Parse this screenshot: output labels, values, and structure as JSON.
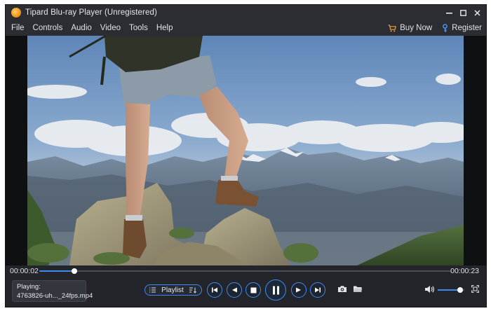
{
  "window": {
    "title": "Tipard Blu-ray Player (Unregistered)"
  },
  "menu": {
    "items": [
      "File",
      "Controls",
      "Audio",
      "Video",
      "Tools",
      "Help"
    ],
    "buy_now": "Buy Now",
    "register": "Register"
  },
  "player": {
    "time_elapsed": "00:00:02",
    "time_total": "00:00:23",
    "progress": 0.086,
    "volume": 0.85
  },
  "now_playing": {
    "label": "Playing:",
    "file": "4763826-uh..._24fps.mp4"
  },
  "playlist": {
    "label": "Playlist"
  },
  "colors": {
    "accent": "#3c8cf0",
    "background": "#23252a",
    "titlebar": "#2b2d33"
  },
  "icons": [
    "app-logo-icon",
    "minimize-icon",
    "maximize-icon",
    "close-icon",
    "cart-icon",
    "key-icon",
    "list-icon",
    "sort-icon",
    "previous-icon",
    "rewind-icon",
    "stop-icon",
    "pause-icon",
    "fast-forward-icon",
    "next-icon",
    "camera-icon",
    "folder-icon",
    "volume-icon",
    "fullscreen-icon"
  ]
}
